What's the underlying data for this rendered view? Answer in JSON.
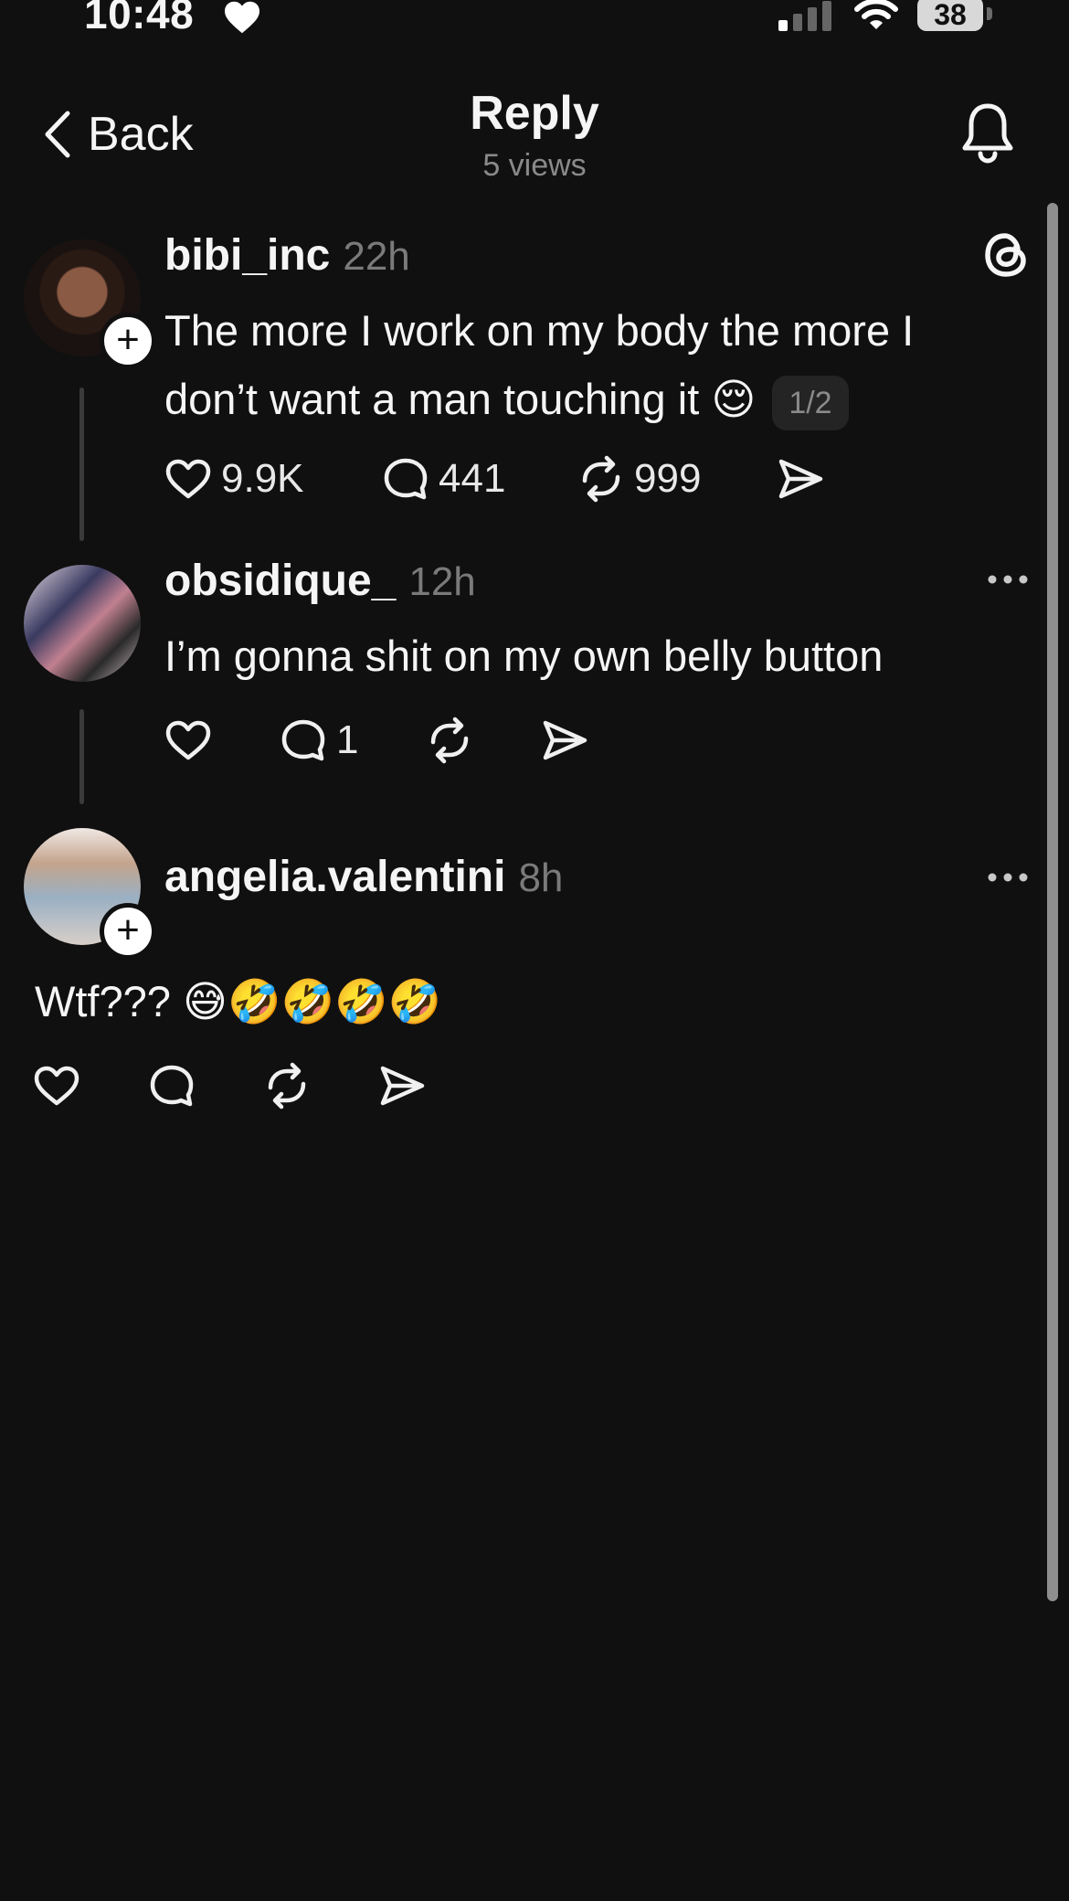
{
  "status_bar": {
    "time": "10:48",
    "battery": "38"
  },
  "header": {
    "back_label": "Back",
    "title": "Reply",
    "views": "5 views"
  },
  "posts": [
    {
      "username": "bibi_inc",
      "time": "22h",
      "text_line1": "The more I work on my body the more I",
      "text_line2": "don’t want a man touching it",
      "emoji": "😌",
      "page_indicator": "1/2",
      "likes": "9.9K",
      "replies": "441",
      "reposts": "999"
    },
    {
      "username": "obsidique_",
      "time": "12h",
      "text": "I’m gonna shit on my own belly button",
      "replies": "1"
    },
    {
      "username": "angelia.valentini",
      "time": "8h",
      "text": "Wtf???",
      "emoji": "😅🤣🤣🤣🤣"
    }
  ],
  "colors": {
    "background": "#101010",
    "text": "#f5f5f5",
    "muted": "#7a7a7a"
  }
}
